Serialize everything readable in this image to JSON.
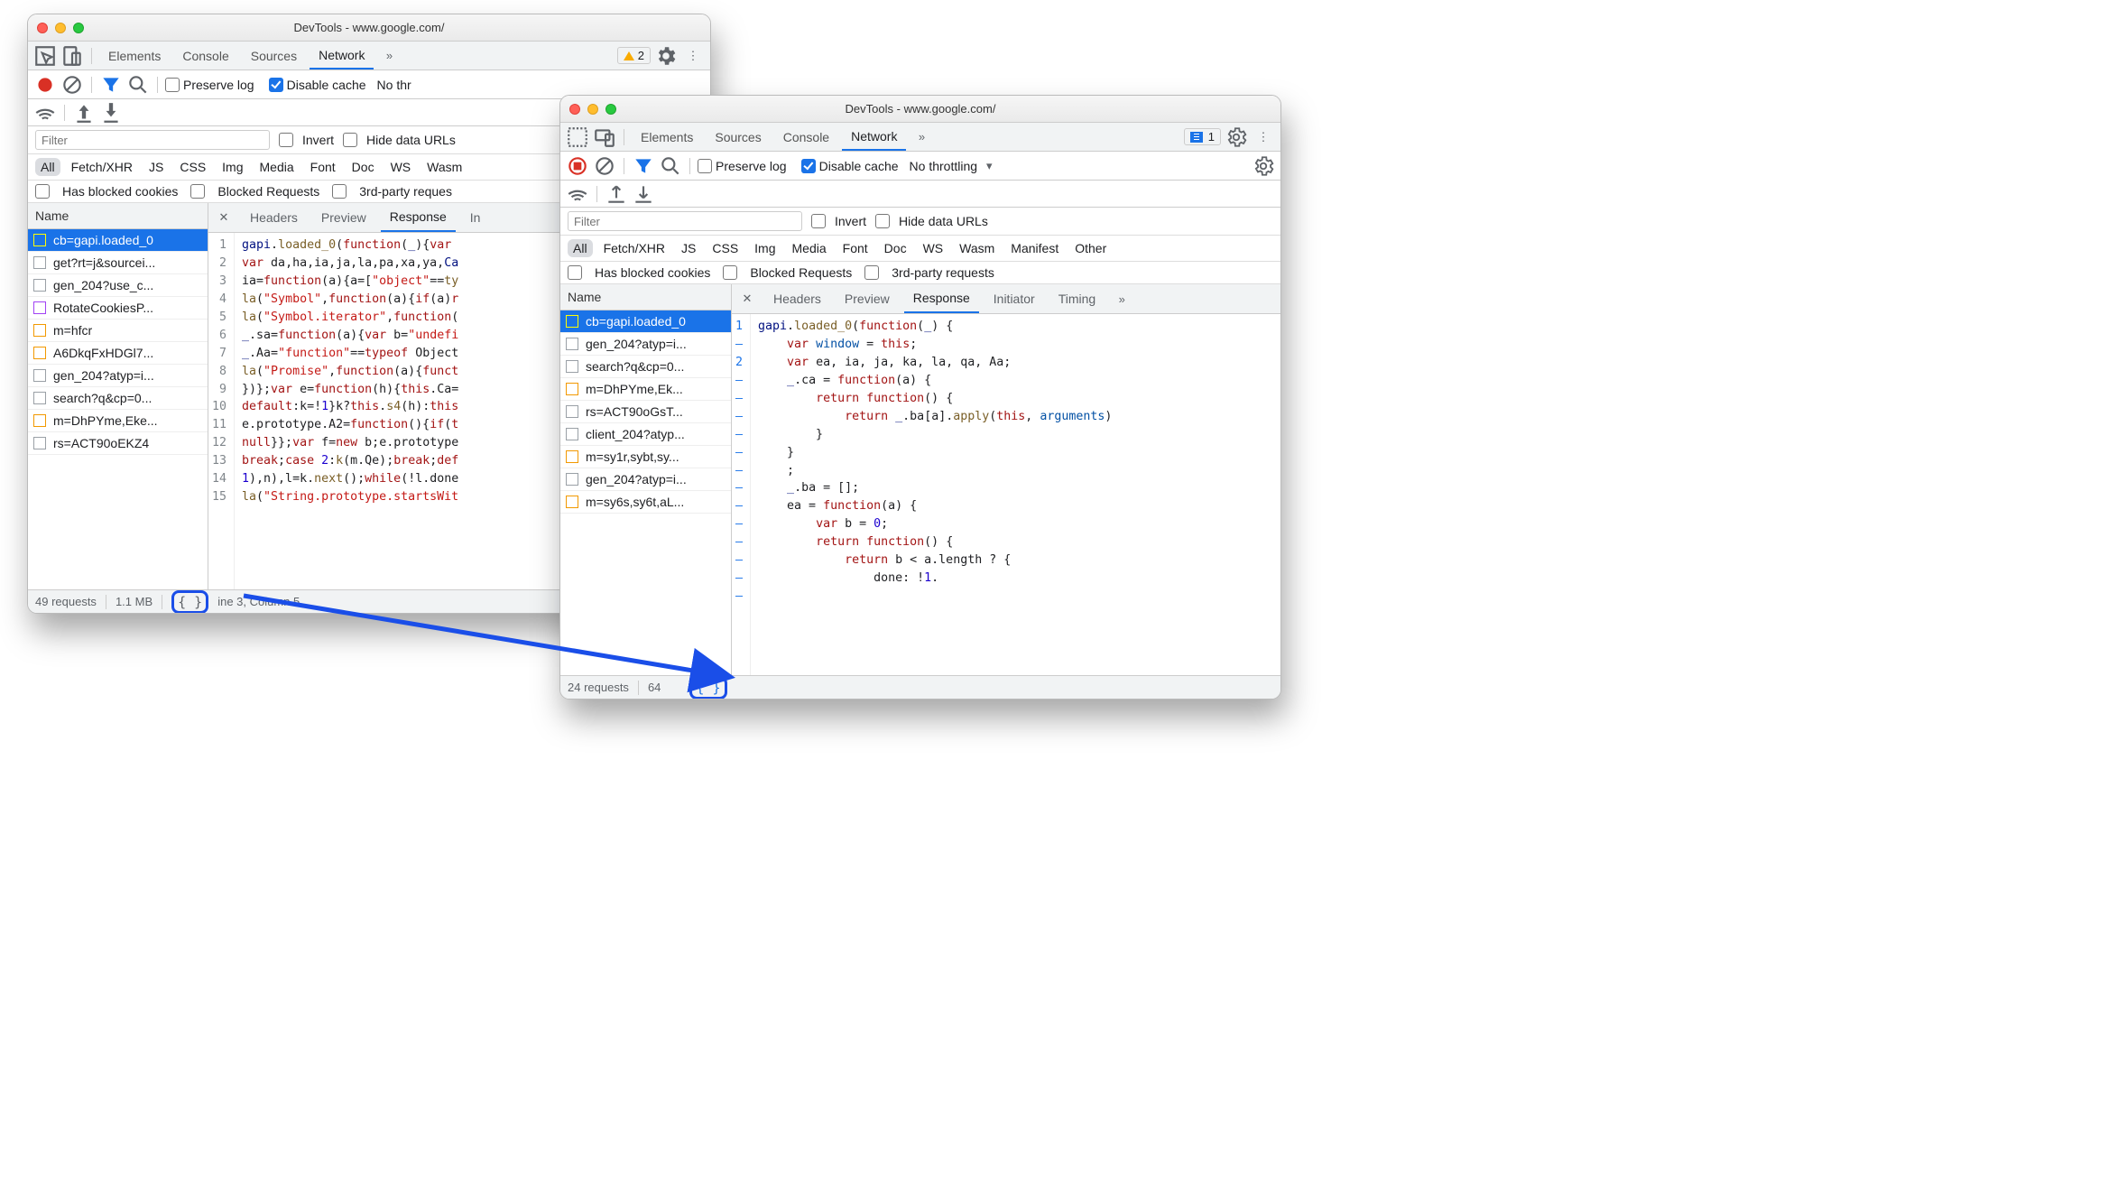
{
  "window1": {
    "title": "DevTools - www.google.com/",
    "tabs": [
      "Elements",
      "Console",
      "Sources",
      "Network"
    ],
    "active_tab": "Network",
    "warnings": "2",
    "preserve_log": "Preserve log",
    "disable_cache": "Disable cache",
    "throttling": "No thr",
    "filter_placeholder": "Filter",
    "invert": "Invert",
    "hide_data": "Hide data URLs",
    "types": [
      "All",
      "Fetch/XHR",
      "JS",
      "CSS",
      "Img",
      "Media",
      "Font",
      "Doc",
      "WS",
      "Wasm"
    ],
    "blocked_cookies": "Has blocked cookies",
    "blocked_req": "Blocked Requests",
    "third_party": "3rd-party reques",
    "name_col": "Name",
    "detail_tabs": [
      "Headers",
      "Preview",
      "Response",
      "In"
    ],
    "requests": [
      {
        "label": "cb=gapi.loaded_0",
        "icon": "orange",
        "sel": true
      },
      {
        "label": "get?rt=j&sourcei...",
        "icon": "grey"
      },
      {
        "label": "gen_204?use_c...",
        "icon": "grey"
      },
      {
        "label": "RotateCookiesP...",
        "icon": "purple"
      },
      {
        "label": "m=hfcr",
        "icon": "orange"
      },
      {
        "label": "A6DkqFxHDGl7...",
        "icon": "orange"
      },
      {
        "label": "gen_204?atyp=i...",
        "icon": "grey"
      },
      {
        "label": "search?q&cp=0...",
        "icon": "grey"
      },
      {
        "label": "m=DhPYme,Eke...",
        "icon": "orange"
      },
      {
        "label": "rs=ACT90oEKZ4",
        "icon": "grey"
      }
    ],
    "code_lines": [
      "1",
      "2",
      "3",
      "4",
      "5",
      "6",
      "7",
      "8",
      "9",
      "10",
      "11",
      "12",
      "13",
      "14",
      "15"
    ],
    "status_requests": "49 requests",
    "status_size": "1.1 MB",
    "status_cursor": "ine 3, Column 5"
  },
  "window2": {
    "title": "DevTools - www.google.com/",
    "tabs": [
      "Elements",
      "Sources",
      "Console",
      "Network"
    ],
    "active_tab": "Network",
    "info": "1",
    "preserve_log": "Preserve log",
    "disable_cache": "Disable cache",
    "throttling": "No throttling",
    "filter_placeholder": "Filter",
    "invert": "Invert",
    "hide_data": "Hide data URLs",
    "types": [
      "All",
      "Fetch/XHR",
      "JS",
      "CSS",
      "Img",
      "Media",
      "Font",
      "Doc",
      "WS",
      "Wasm",
      "Manifest",
      "Other"
    ],
    "blocked_cookies": "Has blocked cookies",
    "blocked_req": "Blocked Requests",
    "third_party": "3rd-party requests",
    "name_col": "Name",
    "detail_tabs": [
      "Headers",
      "Preview",
      "Response",
      "Initiator",
      "Timing"
    ],
    "requests": [
      {
        "label": "cb=gapi.loaded_0",
        "icon": "orange",
        "sel": true
      },
      {
        "label": "gen_204?atyp=i...",
        "icon": "grey"
      },
      {
        "label": "search?q&cp=0...",
        "icon": "grey"
      },
      {
        "label": "m=DhPYme,Ek...",
        "icon": "orange"
      },
      {
        "label": "rs=ACT90oGsT...",
        "icon": "grey"
      },
      {
        "label": "client_204?atyp...",
        "icon": "grey"
      },
      {
        "label": "m=sy1r,sybt,sy...",
        "icon": "orange"
      },
      {
        "label": "gen_204?atyp=i...",
        "icon": "grey"
      },
      {
        "label": "m=sy6s,sy6t,aL...",
        "icon": "orange"
      }
    ],
    "status_requests": "24 requests",
    "status_size": "64"
  }
}
